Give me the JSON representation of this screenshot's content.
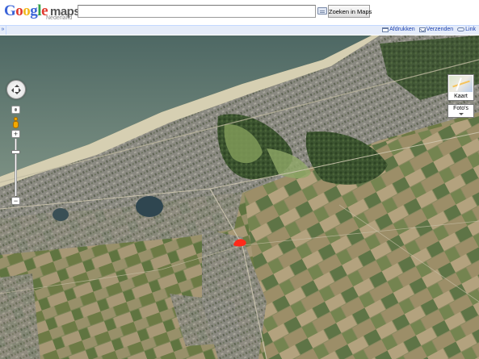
{
  "header": {
    "logo_letters": [
      {
        "char": "G",
        "color": "#3b64d8"
      },
      {
        "char": "o",
        "color": "#e03a2e"
      },
      {
        "char": "o",
        "color": "#f2b91c"
      },
      {
        "char": "g",
        "color": "#3b64d8"
      },
      {
        "char": "l",
        "color": "#35a14a"
      },
      {
        "char": "e",
        "color": "#e03a2e"
      }
    ],
    "logo_product": "maps",
    "logo_country": "Nederland",
    "search": {
      "value": "",
      "placeholder": ""
    },
    "search_button_label": "Zoeken in Maps"
  },
  "actionbar": {
    "collapse_symbol": "»",
    "links": [
      {
        "icon": "print-icon",
        "label": "Afdrukken"
      },
      {
        "icon": "mail-icon",
        "label": "Verzenden"
      },
      {
        "icon": "link-icon",
        "label": "Link"
      }
    ]
  },
  "map": {
    "view": "satellite",
    "controls": {
      "zoom_in_symbol": "+",
      "zoom_out_symbol": "−",
      "zoom_level_fraction": 0.2
    },
    "map_type_button_label": "Kaart",
    "layers_dropdown_label": "Foto's",
    "colors": {
      "sea": "#59706a",
      "beach": "#d8d2b8",
      "urban": "#8a8a80",
      "fields": "#7e8658",
      "woods": "#3f5a2e",
      "pin": "#ff2a1a"
    }
  }
}
